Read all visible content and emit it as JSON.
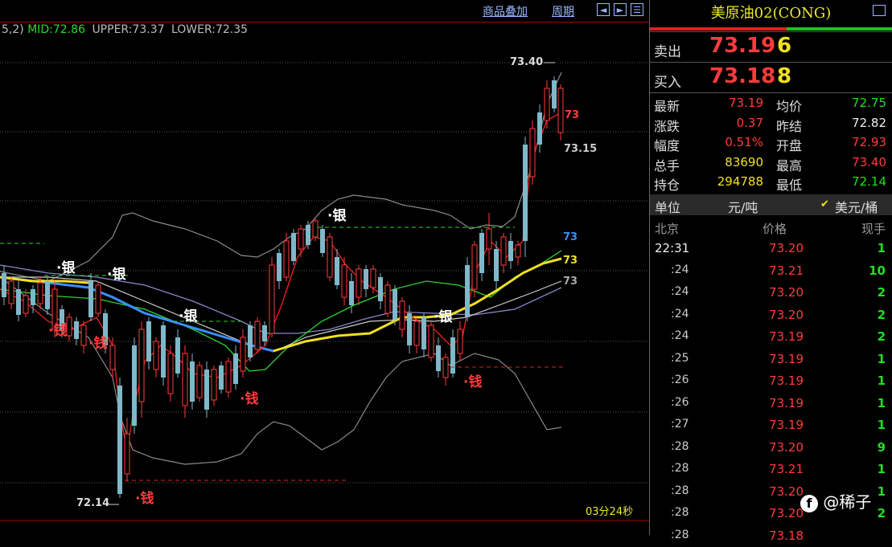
{
  "toolbar": {
    "overlay_label": "商品叠加",
    "period_label": "周期"
  },
  "indicator": {
    "params": "5,2)",
    "mid": "MID:72.86",
    "upper": "UPPER:73.37",
    "lower": "LOWER:72.35"
  },
  "timer": "03分24秒",
  "chart_labels": {
    "high_value": "73.40",
    "low_value": "72.14",
    "last_value": "73.15",
    "ma_red": "73",
    "ma_blue": "73",
    "ma_yellow": "73",
    "ma_gray": "73",
    "marker_silver": "·银",
    "marker_money": "·钱"
  },
  "colors": {
    "up": "#ff3b3b",
    "down": "#20e020",
    "mid_line": "#2ad82a",
    "accent": "#f0e020"
  },
  "panel": {
    "title": "美原油02(CONG)",
    "sell_label": "卖出",
    "sell_price": "73.19",
    "sell_vol": "6",
    "buy_label": "买入",
    "buy_price": "73.18",
    "buy_vol": "8",
    "stats": [
      {
        "k1": "最新",
        "v1": "73.19",
        "k2": "均价",
        "v2": "72.75"
      },
      {
        "k1": "涨跌",
        "v1": "0.37",
        "k2": "昨结",
        "v2": "72.82"
      },
      {
        "k1": "幅度",
        "v1": "0.51%",
        "k2": "开盘",
        "v2": "72.93"
      },
      {
        "k1": "总手",
        "v1": "83690",
        "k2": "最高",
        "v2": "73.40"
      },
      {
        "k1": "持仓",
        "v1": "294788",
        "k2": "最低",
        "v2": "72.14"
      }
    ],
    "unit_label": "单位",
    "unit_value": "元/吨",
    "unit_check": "✔",
    "unit_alt": "美元/桶",
    "ticks_header": {
      "place": "北京",
      "price": "价格",
      "qty": "现手"
    },
    "ticks": [
      {
        "time": "22:31",
        "price": "73.20",
        "qty": "1"
      },
      {
        "time": ":24",
        "price": "73.21",
        "qty": "10"
      },
      {
        "time": ":24",
        "price": "73.20",
        "qty": "2"
      },
      {
        "time": ":24",
        "price": "73.20",
        "qty": "2"
      },
      {
        "time": ":24",
        "price": "73.19",
        "qty": "2"
      },
      {
        "time": ":25",
        "price": "73.19",
        "qty": "1"
      },
      {
        "time": ":26",
        "price": "73.19",
        "qty": "1"
      },
      {
        "time": ":26",
        "price": "73.19",
        "qty": "1"
      },
      {
        "time": ":27",
        "price": "73.19",
        "qty": "1"
      },
      {
        "time": ":28",
        "price": "73.20",
        "qty": "9"
      },
      {
        "time": ":28",
        "price": "73.21",
        "qty": "1"
      },
      {
        "time": ":28",
        "price": "73.20",
        "qty": "1"
      },
      {
        "time": ":28",
        "price": "73.20",
        "qty": "2"
      },
      {
        "time": ":28",
        "price": "73.18",
        "qty": ""
      }
    ]
  },
  "watermark": {
    "icon": "f",
    "text": "@稀子"
  }
}
